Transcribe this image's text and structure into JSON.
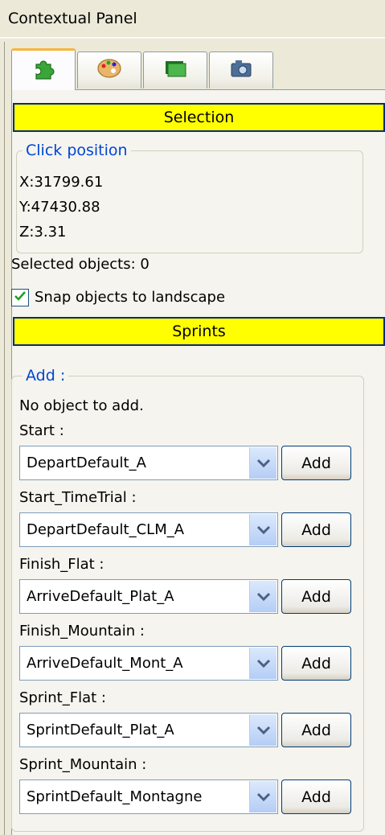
{
  "panel": {
    "title": "Contextual Panel"
  },
  "tabs": [
    {
      "icon": "puzzle-icon",
      "active": true
    },
    {
      "icon": "palette-icon",
      "active": false
    },
    {
      "icon": "layers-icon",
      "active": false
    },
    {
      "icon": "camera-icon",
      "active": false
    }
  ],
  "selection": {
    "button_label": "Selection",
    "click_position": {
      "legend": "Click position",
      "x": "X:31799.61",
      "y": "Y:47430.88",
      "z": "Z:3.31"
    },
    "selected_objects": "Selected objects: 0",
    "snap": {
      "label": "Snap objects to landscape",
      "checked": true
    }
  },
  "sprints": {
    "button_label": "Sprints",
    "add_group": {
      "legend": "Add :",
      "message": "No object to add.",
      "add_label": "Add",
      "rows": [
        {
          "label": "Start :",
          "value": "DepartDefault_A"
        },
        {
          "label": "Start_TimeTrial :",
          "value": "DepartDefault_CLM_A"
        },
        {
          "label": "Finish_Flat :",
          "value": "ArriveDefault_Plat_A"
        },
        {
          "label": "Finish_Mountain :",
          "value": "ArriveDefault_Mont_A"
        },
        {
          "label": "Sprint_Flat :",
          "value": "SprintDefault_Plat_A"
        },
        {
          "label": "Sprint_Mountain :",
          "value": "SprintDefault_Montagne"
        }
      ]
    }
  },
  "colors": {
    "accent_yellow": "#ffff00",
    "legend_blue": "#0046d5",
    "panel_bg": "#ece9d8"
  }
}
